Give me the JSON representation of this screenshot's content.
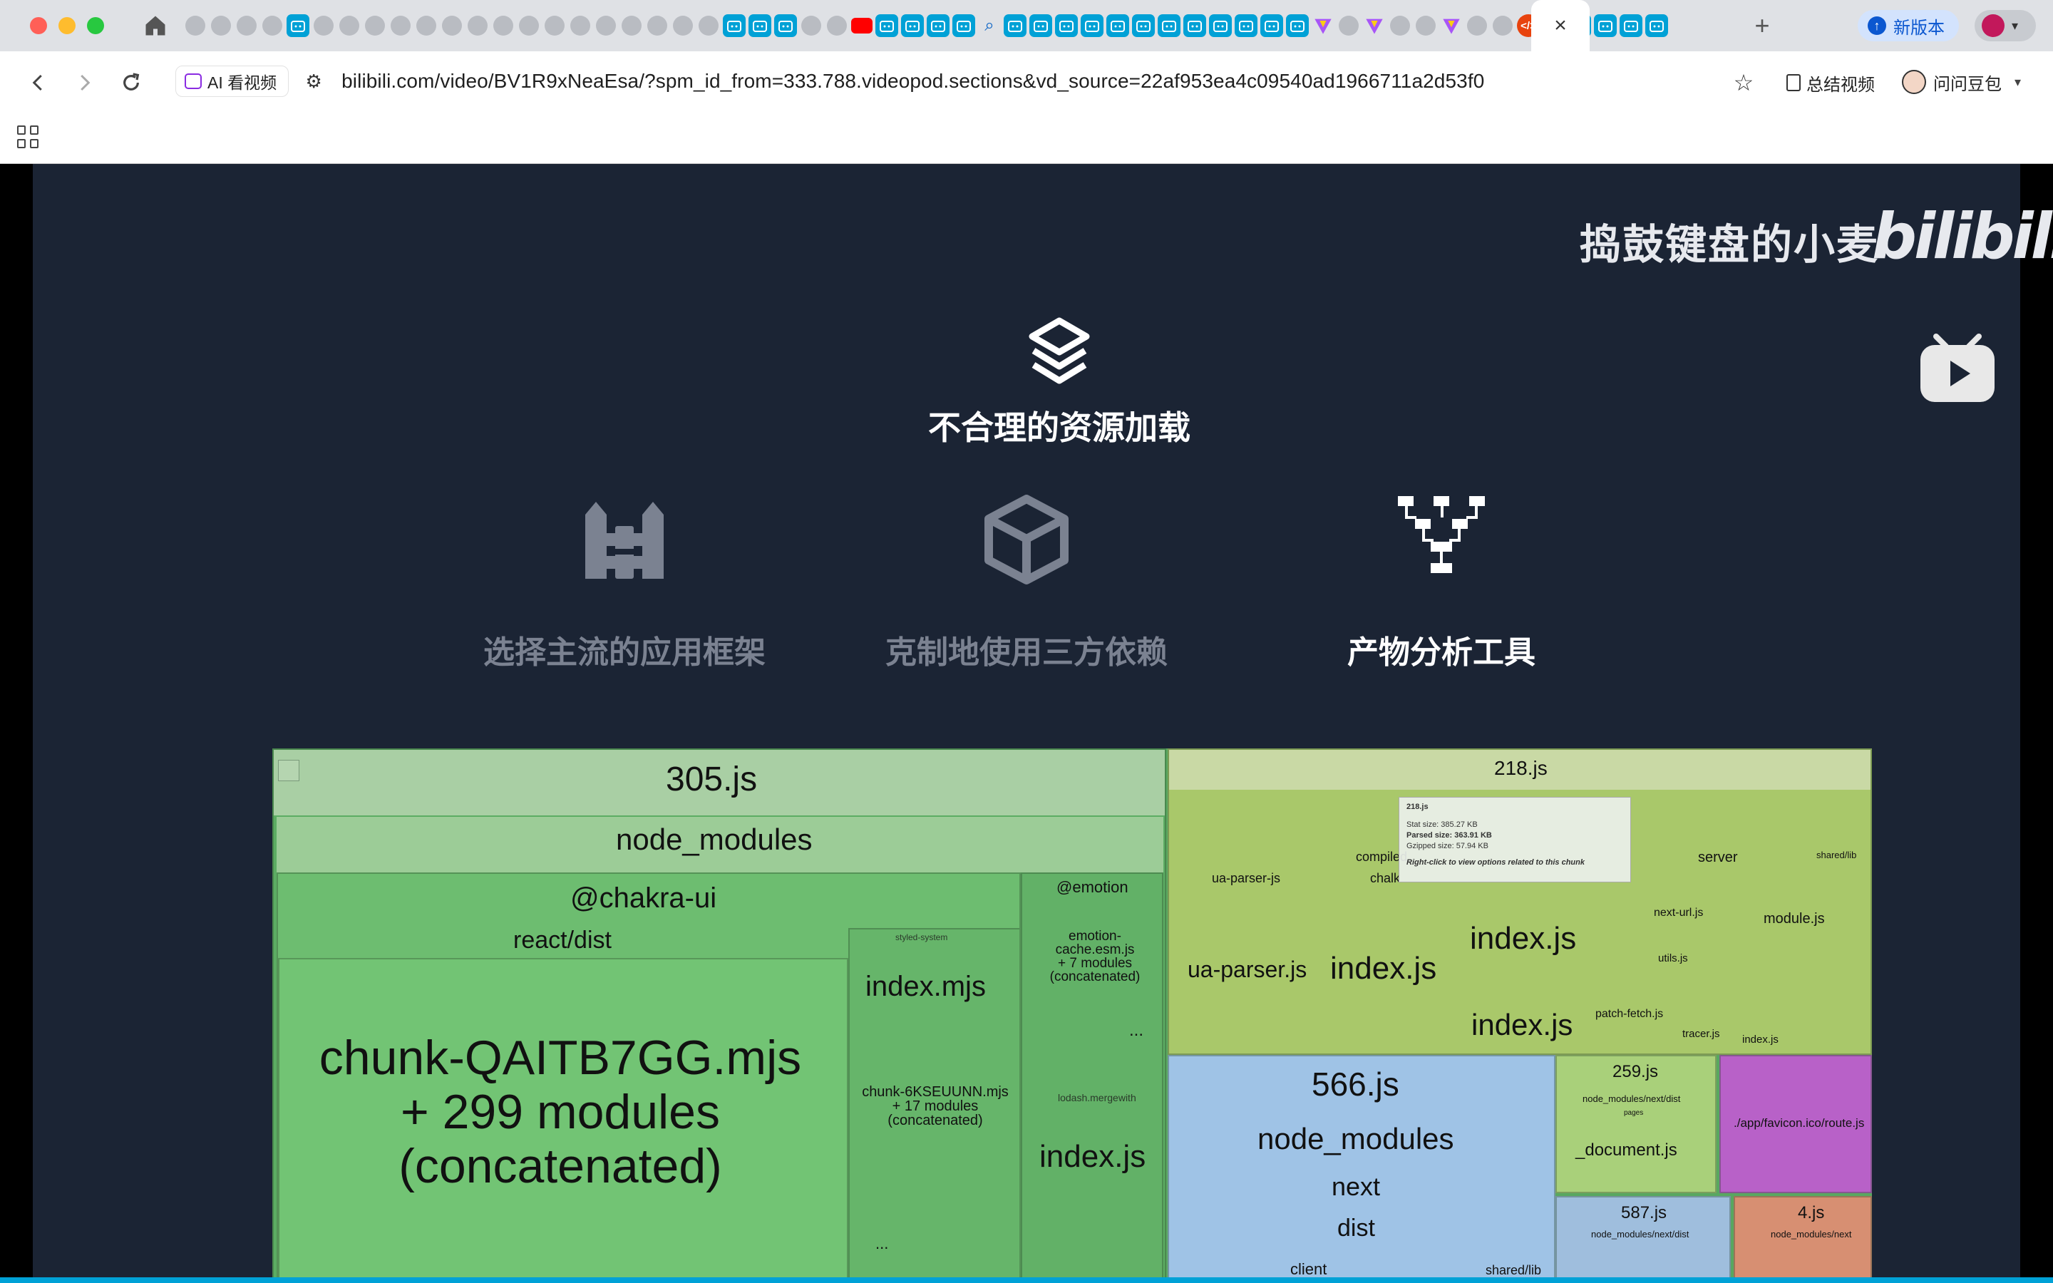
{
  "browser": {
    "active_tab_close": "×",
    "new_tab": "+",
    "new_version_label": "新版本",
    "new_version_icon": "arrow-up-icon",
    "address": {
      "ai_chip_label": "AI 看视频",
      "url_host": "bilibili.com",
      "url_path": "/video/BV1R9xNeaEsa/?spm_id_from=333.788.videopod.sections&vd_source=22af953ea4c09540ad1966711a2d53f0"
    },
    "summary_label": "总结视频",
    "ask_label": "问问豆包"
  },
  "video": {
    "watermark_text": "捣鼓键盘的小麦",
    "watermark_logo": "bilibili",
    "top_title": "不合理的资源加载",
    "pillars": [
      {
        "label": "选择主流的应用框架",
        "icon": "fence-icon",
        "active": false
      },
      {
        "label": "克制地使用三方依赖",
        "icon": "package-icon",
        "active": false
      },
      {
        "label": "产物分析工具",
        "icon": "sitemap-icon",
        "active": true
      }
    ],
    "treemap": {
      "chunk_305": "305.js",
      "node_modules_a": "node_modules",
      "chakra": "@chakra-ui",
      "react_dist": "react/dist",
      "chunk_main_1": "chunk-QAITB7GG.mjs",
      "chunk_main_2": "+ 299 modules",
      "chunk_main_3": "(concatenated)",
      "index_mjs": "index.mjs",
      "chunk_6k_1": "chunk-6KSEUUNN.mjs",
      "chunk_6k_2": "+ 17 modules",
      "chunk_6k_3": "(concatenated)",
      "emotion": "@emotion",
      "emotion_cache_1": "emotion-cache.esm.js",
      "emotion_cache_2": "+ 7 modules",
      "emotion_cache_3": "(concatenated)",
      "lodash_merge": "lodash.mergewith",
      "index_js_a": "index.js",
      "styled_system": "styled-system",
      "ellipsis": "...",
      "chunk_218": "218.js",
      "ua_parser_top": "ua-parser-js",
      "ua_parser_js": "ua-parser.js",
      "compiled": "compiled",
      "chalk": "chalk",
      "index_js_b": "index.js",
      "index_js_c": "index.js",
      "index_js_d": "index.js",
      "server": "server",
      "next_url": "next-url.js",
      "module_js": "module.js",
      "utils_js": "utils.js",
      "patch_fetch": "patch-fetch.js",
      "tracer": "tracer.js",
      "shared_lib": "shared/lib",
      "index_js_e": "index.js",
      "tooltip_title": "218.js",
      "tooltip_stat": "Stat size: 385.27 KB",
      "tooltip_parsed": "Parsed size: 363.91 KB",
      "tooltip_gzip": "Gzipped size: 57.94 KB",
      "tooltip_hint": "Right-click to view options related to this chunk",
      "chunk_566": "566.js",
      "node_modules_b": "node_modules",
      "next": "next",
      "dist": "dist",
      "client": "client",
      "shared_lib_b": "shared/lib",
      "chunk_259": "259.js",
      "nm_next_dist": "node_modules/next/dist",
      "pages": "pages",
      "document_js": "_document.js",
      "favicon": "./app/favicon.ico/route.js",
      "chunk_587": "587.js",
      "nm_next_dist_b": "node_modules/next/dist",
      "chunk_4": "4.js",
      "nm_next_c": "node_modules/next"
    }
  },
  "colors": {
    "slide_bg": "#1b2434",
    "bilibili_blue": "#00a1d6",
    "treemap_green": "#58a760",
    "treemap_blue": "#8fb8e0",
    "treemap_purple": "#b04fc4"
  }
}
